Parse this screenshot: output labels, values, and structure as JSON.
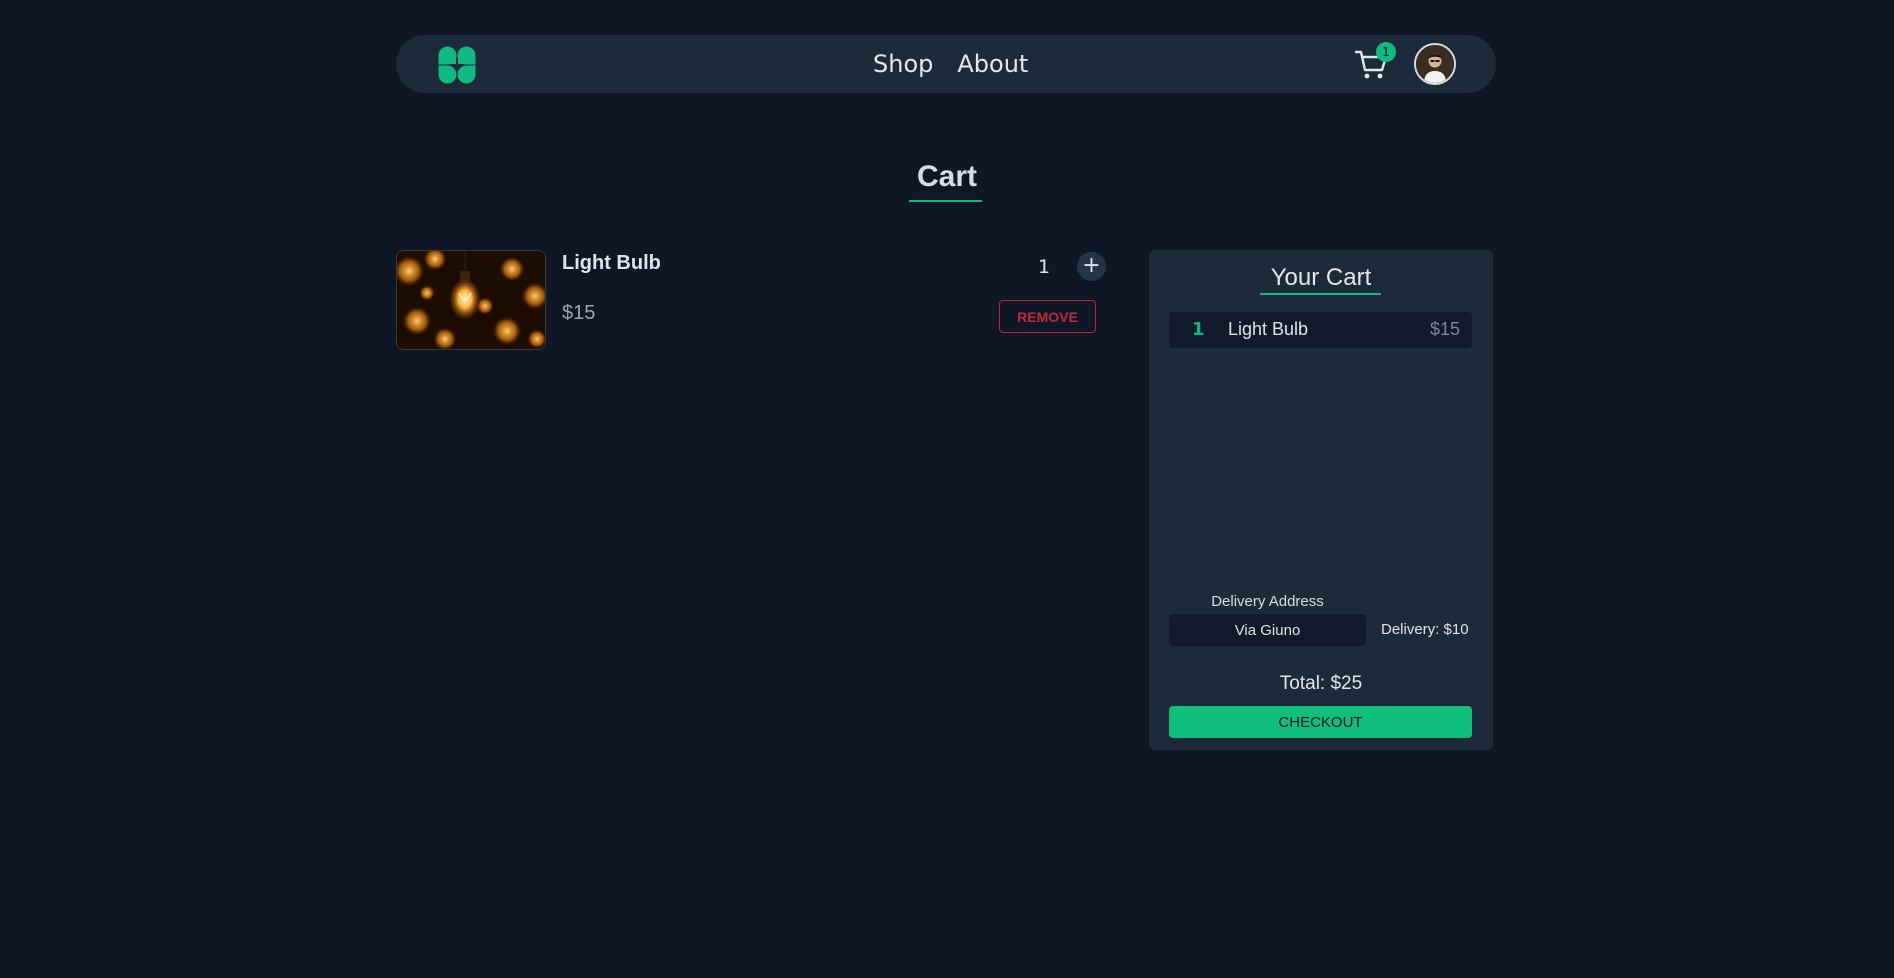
{
  "navbar": {
    "logo_icon": "four-petal-clover-logo",
    "links": [
      {
        "label": "Shop"
      },
      {
        "label": "About"
      }
    ],
    "cart_icon": "shopping-cart-icon",
    "cart_count": "1",
    "avatar_icon": "user-avatar"
  },
  "page": {
    "title": "Cart"
  },
  "cart_items": [
    {
      "name": "Light Bulb",
      "price": "$15",
      "quantity": "1",
      "plus_label": "+",
      "remove_label": "REMOVE",
      "image_icon": "light-bulb-photo"
    }
  ],
  "summary": {
    "title": "Your Cart",
    "items": [
      {
        "qty": "1",
        "name": "Light Bulb",
        "price": "$15"
      }
    ],
    "address_label": "Delivery Address",
    "address_value": "Via Giuno",
    "delivery_fee": "Delivery: $10",
    "total": "Total: $25",
    "checkout_label": "CHECKOUT"
  },
  "colors": {
    "background": "#0f1727",
    "panel": "#1d2a3a",
    "accent": "#10b981",
    "danger": "#c0283e"
  }
}
